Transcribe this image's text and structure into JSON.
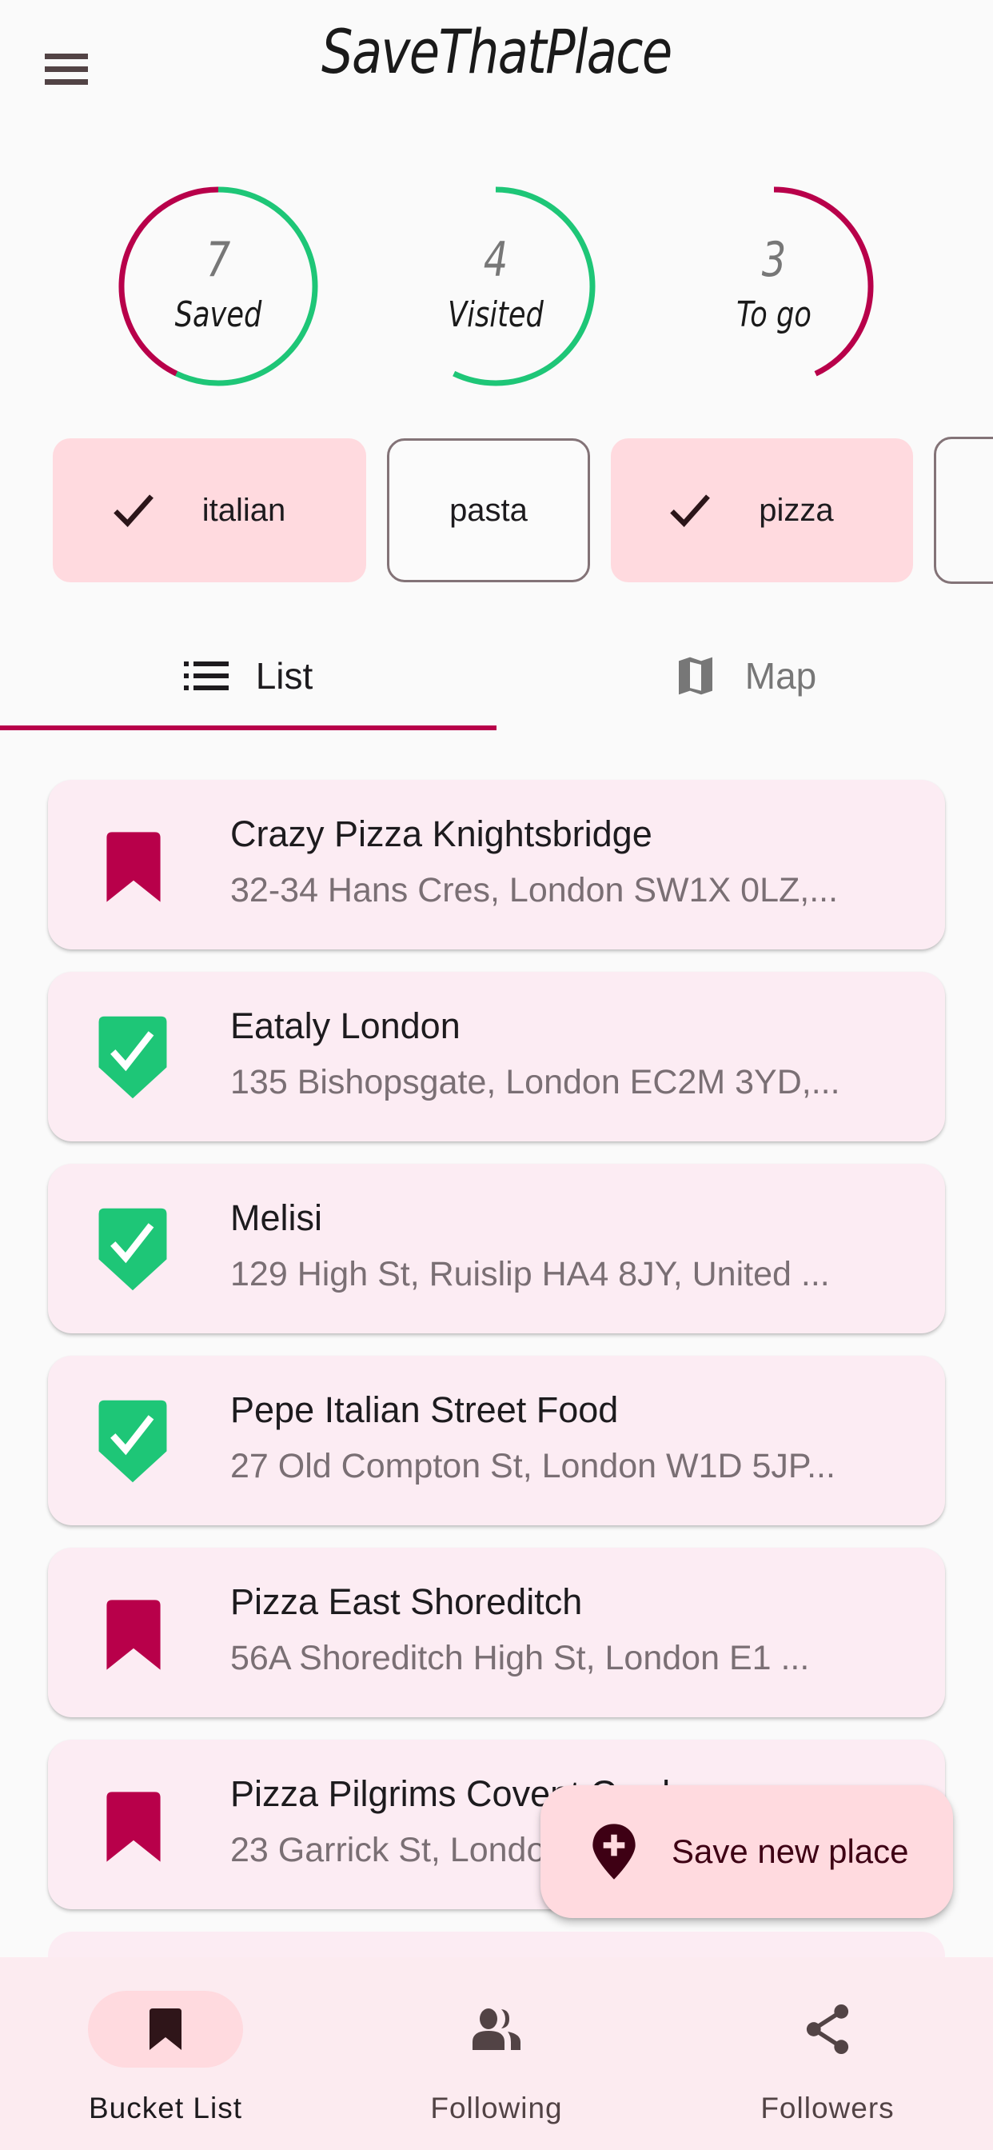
{
  "header": {
    "title": "SaveThatPlace",
    "menu_icon": "hamburger-menu-icon"
  },
  "colors": {
    "accent": "#b8004a",
    "visited": "#1ec677",
    "chip_selected_bg": "#ffdadf",
    "card_bg": "#fcecf3",
    "nav_bg": "#fcebf0"
  },
  "stats": [
    {
      "value": "7",
      "label": "Saved",
      "visited_fraction": 0.571,
      "togo_fraction": 0.429
    },
    {
      "value": "4",
      "label": "Visited",
      "fraction": 0.571
    },
    {
      "value": "3",
      "label": "To go",
      "fraction": 0.429
    }
  ],
  "chips": [
    {
      "label": "italian",
      "selected": true
    },
    {
      "label": "pasta",
      "selected": false
    },
    {
      "label": "pizza",
      "selected": true
    }
  ],
  "tabs": [
    {
      "label": "List",
      "icon": "list-icon",
      "active": true
    },
    {
      "label": "Map",
      "icon": "map-icon",
      "active": false
    }
  ],
  "places": [
    {
      "name": "Crazy Pizza Knightsbridge",
      "address": "32-34 Hans Cres, London SW1X 0LZ,...",
      "status": "saved"
    },
    {
      "name": "Eataly London",
      "address": "135 Bishopsgate, London EC2M 3YD,...",
      "status": "visited"
    },
    {
      "name": "Melisi",
      "address": "129 High St, Ruislip HA4 8JY, United ...",
      "status": "visited"
    },
    {
      "name": "Pepe Italian Street Food",
      "address": "27 Old Compton St, London W1D 5JP...",
      "status": "visited"
    },
    {
      "name": "Pizza East Shoreditch",
      "address": "56A Shoreditch High St, London E1 ...",
      "status": "saved"
    },
    {
      "name": "Pizza Pilgrims Covent Garden",
      "address": "23 Garrick St, London",
      "status": "saved"
    }
  ],
  "fab": {
    "label": "Save new place",
    "icon": "add-location-icon"
  },
  "bottom_nav": [
    {
      "label": "Bucket List",
      "icon": "bookmark-icon",
      "active": true
    },
    {
      "label": "Following",
      "icon": "people-icon",
      "active": false
    },
    {
      "label": "Followers",
      "icon": "share-icon",
      "active": false
    }
  ]
}
